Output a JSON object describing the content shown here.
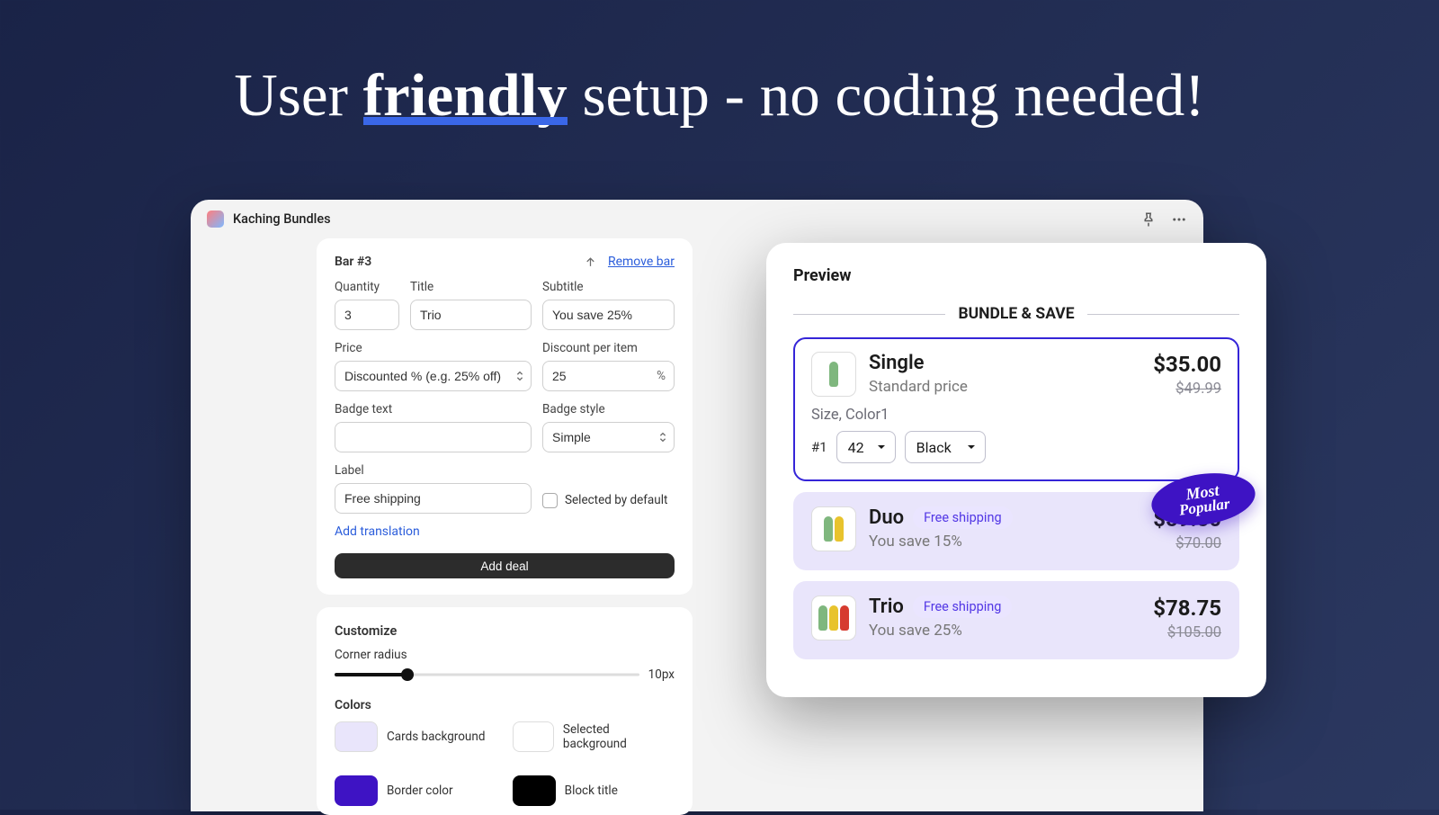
{
  "headline": {
    "pre": "User ",
    "bold": "friendly",
    "post": " setup - no coding needed!"
  },
  "app": {
    "name": "Kaching Bundles"
  },
  "bar": {
    "title": "Bar #3",
    "remove": "Remove bar",
    "quantity_label": "Quantity",
    "quantity_value": "3",
    "title_label": "Title",
    "title_value": "Trio",
    "subtitle_label": "Subtitle",
    "subtitle_value": "You save 25%",
    "price_label": "Price",
    "price_value": "Discounted % (e.g. 25% off)",
    "discount_label": "Discount per item",
    "discount_value": "25",
    "discount_unit": "%",
    "badge_text_label": "Badge text",
    "badge_text_value": "",
    "badge_style_label": "Badge style",
    "badge_style_value": "Simple",
    "label_label": "Label",
    "label_value": "Free shipping",
    "selected_default": "Selected by default",
    "add_translation": "Add translation",
    "add_deal": "Add deal"
  },
  "customize": {
    "title": "Customize",
    "corner_label": "Corner radius",
    "corner_value": "10px",
    "colors_title": "Colors",
    "swatches": [
      {
        "label": "Cards background",
        "hex": "#e9e5fb"
      },
      {
        "label": "Selected background",
        "hex": "#ffffff"
      },
      {
        "label": "Border color",
        "hex": "#3e13c4"
      },
      {
        "label": "Block title",
        "hex": "#000000"
      }
    ]
  },
  "preview": {
    "title": "Preview",
    "bundle_header": "BUNDLE & SAVE",
    "variant_label": "Size, Color1",
    "variant_index": "#1",
    "variant_size": "42",
    "variant_color": "Black",
    "popular": {
      "l1": "Most",
      "l2": "Popular"
    },
    "cards": [
      {
        "title": "Single",
        "sub": "Standard price",
        "price": "$35.00",
        "old": "$49.99",
        "tag": null
      },
      {
        "title": "Duo",
        "sub": "You save 15%",
        "price": "$59.50",
        "old": "$70.00",
        "tag": "Free shipping"
      },
      {
        "title": "Trio",
        "sub": "You save 25%",
        "price": "$78.75",
        "old": "$105.00",
        "tag": "Free shipping"
      }
    ]
  }
}
